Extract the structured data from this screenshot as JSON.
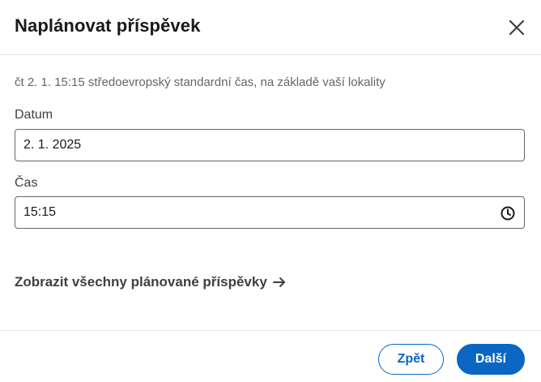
{
  "dialog": {
    "title": "Naplánovat příspěvek",
    "close_icon": "close-icon"
  },
  "info": {
    "text": "čt 2. 1. 15:15 středoevropský standardní čas, na základě vaší lokality"
  },
  "date_field": {
    "label": "Datum",
    "value": "2. 1. 2025"
  },
  "time_field": {
    "label": "Čas",
    "value": "15:15",
    "icon": "clock-icon"
  },
  "view_all_link": {
    "label": "Zobrazit všechny plánované příspěvky",
    "icon": "arrow-right-icon"
  },
  "footer": {
    "back_label": "Zpět",
    "next_label": "Další"
  },
  "colors": {
    "accent": "#0a66c2",
    "text": "#191919",
    "muted": "#666666"
  }
}
